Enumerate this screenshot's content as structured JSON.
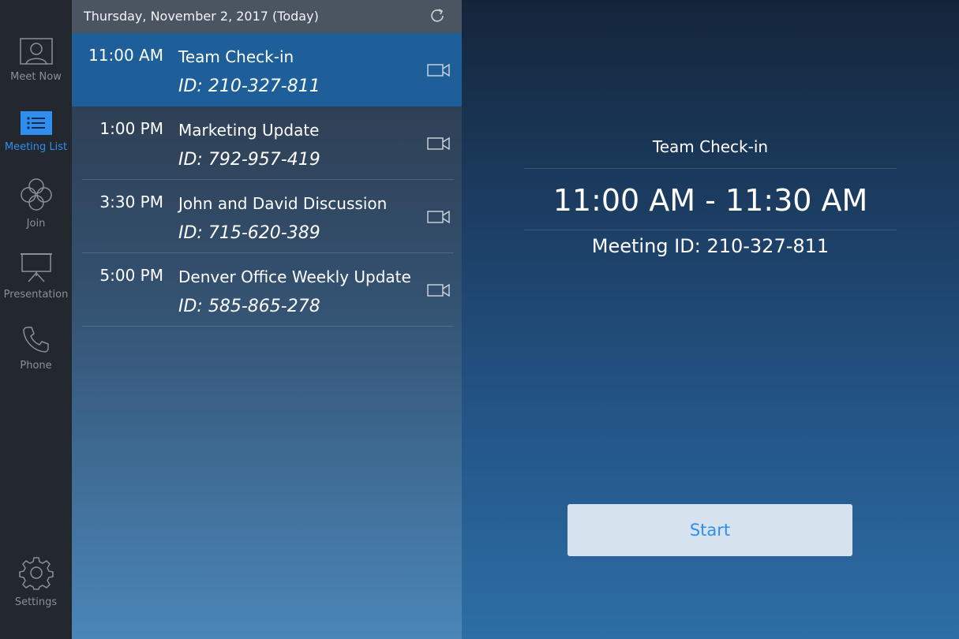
{
  "nav": {
    "items": [
      {
        "label": "Meet Now",
        "icon": "person-icon"
      },
      {
        "label": "Meeting List",
        "icon": "list-icon"
      },
      {
        "label": "Join",
        "icon": "join-icon"
      },
      {
        "label": "Presentation",
        "icon": "presentation-icon"
      },
      {
        "label": "Phone",
        "icon": "phone-icon"
      }
    ],
    "settings": {
      "label": "Settings",
      "icon": "gear-icon"
    },
    "active_color": "#2f8ef0"
  },
  "list": {
    "date": "Thursday, November 2, 2017 (Today)",
    "meetings": [
      {
        "time": "11:00 AM",
        "title": "Team Check-in",
        "id": "ID: 210-327-811"
      },
      {
        "time": "1:00 PM",
        "title": "Marketing Update",
        "id": "ID: 792-957-419"
      },
      {
        "time": "3:30 PM",
        "title": "John and David Discussion",
        "id": "ID: 715-620-389"
      },
      {
        "time": "5:00 PM",
        "title": "Denver Office Weekly Update",
        "id": "ID: 585-865-278"
      }
    ]
  },
  "detail": {
    "title": "Team Check-in",
    "time_range": "11:00 AM - 11:30 AM",
    "meeting_id": "Meeting ID: 210-327-811",
    "start_label": "Start"
  }
}
